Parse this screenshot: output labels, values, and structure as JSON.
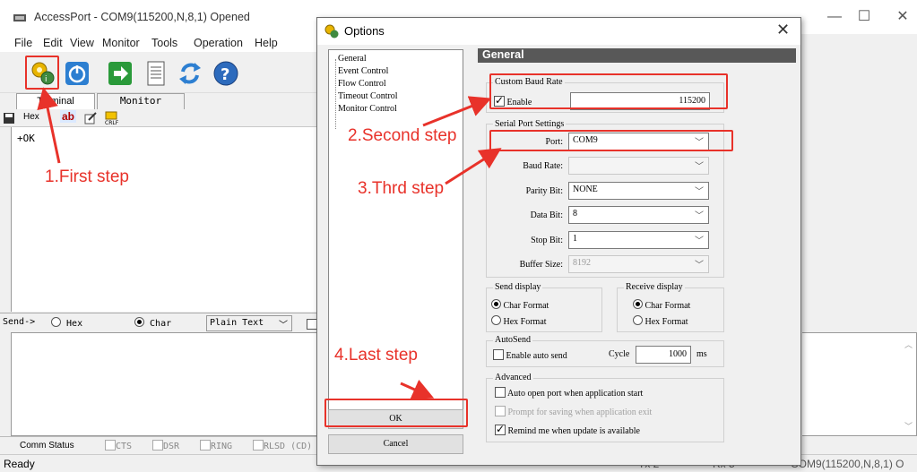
{
  "main_window": {
    "title": "AccessPort - COM9(115200,N,8,1) Opened",
    "controls": {
      "minimize": "—",
      "maximize": "☐",
      "close": "✕"
    },
    "menu": [
      "File",
      "Edit",
      "View",
      "Monitor",
      "Tools",
      "Operation",
      "Help"
    ],
    "tabs": [
      "Terminal",
      "Monitor"
    ],
    "subtoolbar": {
      "hex": "Hex",
      "ab": "ab"
    },
    "terminal_output": "+OK",
    "send_bar": {
      "label": "Send->",
      "hex": "Hex",
      "char": "Char",
      "mode": "Plain Text"
    },
    "comm_status": {
      "label": "Comm Status",
      "cts": "CTS",
      "dsr": "DSR",
      "ring": "RING",
      "rlsd": "RLSD (CD)"
    },
    "status": {
      "ready": "Ready",
      "tx": "Tx 2",
      "rx": "Rx 5",
      "port": "COM9(115200,N,8,1) O"
    }
  },
  "dialog": {
    "title": "Options",
    "close": "✕",
    "tree": [
      "General",
      "Event Control",
      "Flow Control",
      "Timeout Control",
      "Monitor Control"
    ],
    "panel_title": "General",
    "custom_baud": {
      "group": "Custom Baud Rate",
      "enable": "Enable",
      "value": "115200"
    },
    "serial": {
      "group": "Serial Port Settings",
      "port_label": "Port:",
      "port": "COM9",
      "baud_label": "Baud Rate:",
      "baud": "",
      "parity_label": "Parity Bit:",
      "parity": "NONE",
      "data_label": "Data Bit:",
      "data": "8",
      "stop_label": "Stop Bit:",
      "stop": "1",
      "buffer_label": "Buffer Size:",
      "buffer": "8192"
    },
    "send_display": {
      "group": "Send display",
      "char": "Char Format",
      "hex": "Hex  Format"
    },
    "receive_display": {
      "group": "Receive display",
      "char": "Char Format",
      "hex": "Hex  Format"
    },
    "autosend": {
      "group": "AutoSend",
      "enable": "Enable auto send",
      "cycle_label": "Cycle",
      "cycle": "1000",
      "unit": "ms"
    },
    "advanced": {
      "group": "Advanced",
      "auto_open": "Auto open port when application start",
      "prompt_save": "Prompt for saving when application exit",
      "remind": "Remind me when update is available"
    },
    "ok": "OK",
    "cancel": "Cancel"
  },
  "annotations": {
    "step1": "1.First step",
    "step2": "2.Second step",
    "step3": "3.Thrd step",
    "step4": "4.Last step",
    "color": "#e8322a"
  }
}
